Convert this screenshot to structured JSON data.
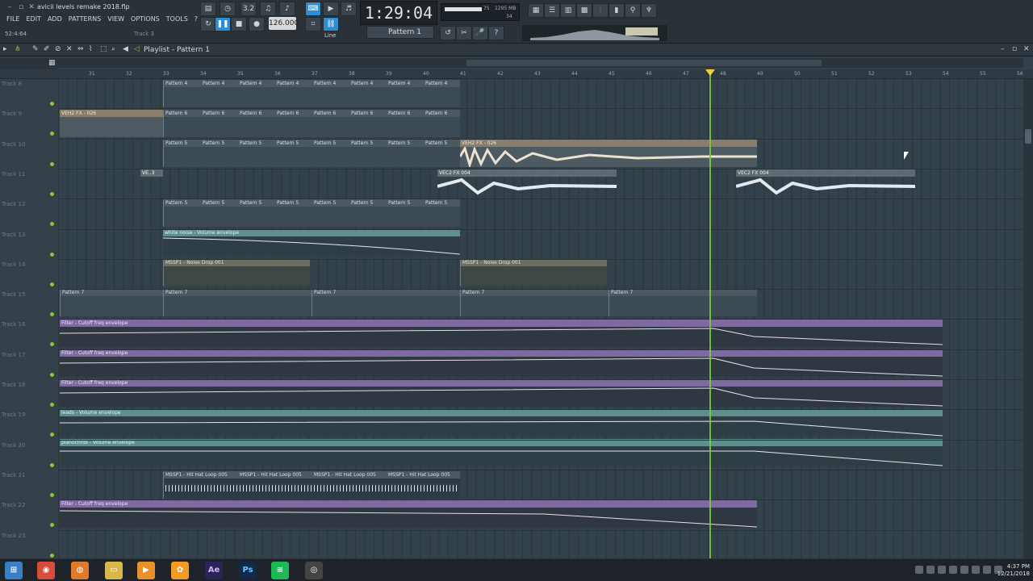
{
  "window": {
    "title": "avicii levels remake 2018.flp",
    "hint": "52:4:64",
    "hint_track": "Track 3"
  },
  "menu": [
    "FILE",
    "EDIT",
    "ADD",
    "PATTERNS",
    "VIEW",
    "OPTIONS",
    "TOOLS",
    "?"
  ],
  "transport": {
    "tempo": "126.000",
    "time": "1:29:04",
    "pattern": "Pattern 1",
    "cpu": "75",
    "mem": "1295 MB",
    "poly": "34",
    "snap": "Line"
  },
  "playlist": {
    "title": "Playlist - Pattern 1"
  },
  "ruler": [
    "31",
    "32",
    "33",
    "34",
    "35",
    "36",
    "37",
    "38",
    "39",
    "40",
    "41",
    "42",
    "43",
    "44",
    "45",
    "46",
    "47",
    "48",
    "49",
    "50",
    "51",
    "52",
    "53",
    "54",
    "55",
    "56"
  ],
  "tracks": [
    "Track 8",
    "Track 9",
    "Track 10",
    "Track 11",
    "Track 12",
    "Track 13",
    "Track 14",
    "Track 15",
    "Track 16",
    "Track 17",
    "Track 18",
    "Track 19",
    "Track 20",
    "Track 21",
    "Track 22",
    "Track 23"
  ],
  "clips": {
    "pattern4": "Pattern 4",
    "pattern6": "Pattern 6",
    "pattern5": "Pattern 5",
    "pattern7": "Pattern 7",
    "veh2_026": "VEH2 FX - 026",
    "veh2_004": "VEC2 FX 004",
    "ve3": "VE..3",
    "white_noise": "white noise - Volume envelope",
    "noise_drop": "MSSP1 - Noise Drop 001",
    "filter": "Filter - Cutoff freq envelope",
    "leads": "leads - Volume envelope",
    "pianochrds": "pianochrds - Volume envelope",
    "hat_loop": "MSSP1 - Hit Hat Loop 005"
  },
  "taskbar": {
    "time": "4:37 PM",
    "date": "12/21/2018",
    "apps": [
      "start-icon",
      "chrome-icon",
      "firefox-icon",
      "explorer-icon",
      "media-icon",
      "fl-studio-icon",
      "after-effects-icon",
      "photoshop-icon",
      "spotify-icon",
      "obs-icon"
    ]
  }
}
